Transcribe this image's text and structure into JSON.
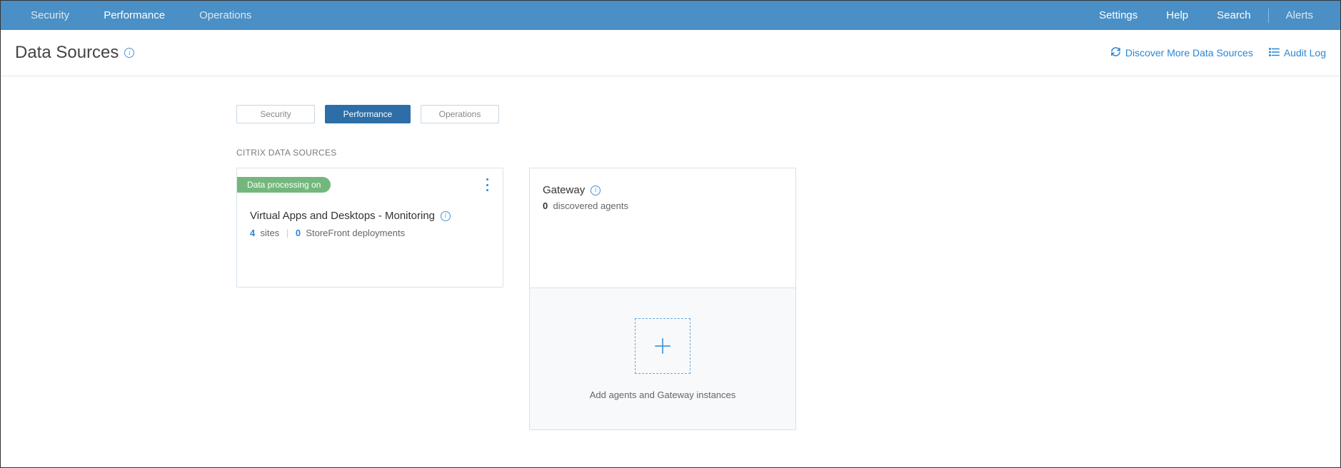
{
  "topnav": {
    "left": [
      "Security",
      "Performance",
      "Operations"
    ],
    "active_index": 1,
    "right": [
      "Settings",
      "Help",
      "Search"
    ],
    "alerts": "Alerts"
  },
  "page": {
    "title": "Data Sources",
    "discover_link": "Discover More Data Sources",
    "audit_link": "Audit Log"
  },
  "tabs": {
    "items": [
      "Security",
      "Performance",
      "Operations"
    ],
    "active_index": 1
  },
  "section_label": "CITRIX DATA SOURCES",
  "card_vad": {
    "badge": "Data processing on",
    "title": "Virtual Apps and Desktops - Monitoring",
    "sites_count": "4",
    "sites_label": "sites",
    "sf_count": "0",
    "sf_label": "StoreFront deployments"
  },
  "card_gateway": {
    "title": "Gateway",
    "agents_count": "0",
    "agents_label": "discovered agents",
    "add_caption": "Add agents and Gateway instances"
  }
}
